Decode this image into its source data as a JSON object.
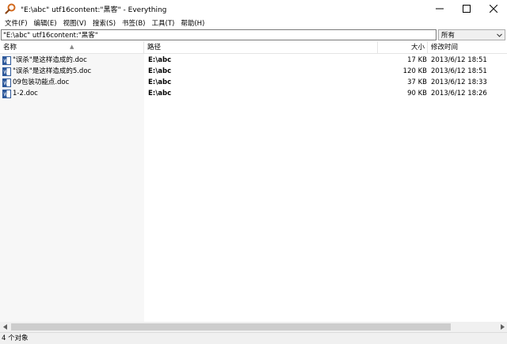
{
  "window": {
    "title": "\"E:\\abc\" utf16content:\"黑客\" - Everything",
    "buttons": {
      "minimize": "minimize",
      "maximize": "maximize",
      "close": "close"
    }
  },
  "menu": [
    {
      "label": "文件(F)"
    },
    {
      "label": "编辑(E)"
    },
    {
      "label": "视图(V)"
    },
    {
      "label": "搜索(S)"
    },
    {
      "label": "书签(B)"
    },
    {
      "label": "工具(T)"
    },
    {
      "label": "帮助(H)"
    }
  ],
  "search": {
    "value": "\"E:\\abc\" utf16content:\"黑客\"",
    "filter": "所有"
  },
  "columns": {
    "name": "名称",
    "path": "路径",
    "size": "大小",
    "modified": "修改时间"
  },
  "rows": [
    {
      "name": "\"误杀\"是这样造成的.doc",
      "path": "E:\\abc",
      "size": "17 KB",
      "modified": "2013/6/12 18:51"
    },
    {
      "name": "\"误杀\"是这样造成的5.doc",
      "path": "E:\\abc",
      "size": "120 KB",
      "modified": "2013/6/12 18:51"
    },
    {
      "name": "09包装功能点.doc",
      "path": "E:\\abc",
      "size": "37 KB",
      "modified": "2013/6/12 18:33"
    },
    {
      "name": "1-2.doc",
      "path": "E:\\abc",
      "size": "90 KB",
      "modified": "2013/6/12 18:26"
    }
  ],
  "status": {
    "text": "4 个对象"
  },
  "icons": {
    "app": "magnifier-icon",
    "file": "word-doc-icon"
  },
  "colors": {
    "app_icon": "#d2691e",
    "doc_icon": "#2b579a"
  }
}
